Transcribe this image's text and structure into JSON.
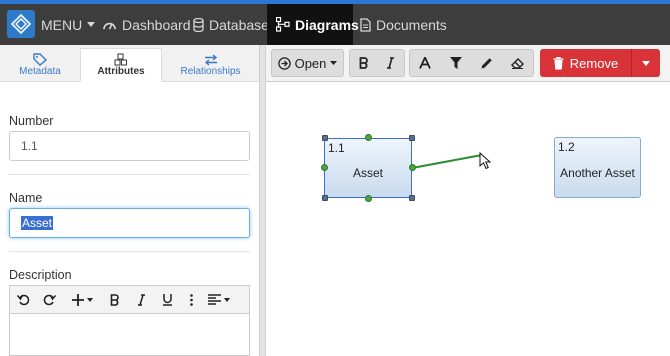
{
  "nav": {
    "menu_label": "MENU",
    "items": [
      {
        "label": "Dashboard"
      },
      {
        "label": "Database"
      },
      {
        "label": "Diagrams"
      },
      {
        "label": "Documents"
      }
    ]
  },
  "left_tabs": [
    {
      "label": "Metadata"
    },
    {
      "label": "Attributes"
    },
    {
      "label": "Relationships"
    }
  ],
  "form": {
    "number_label": "Number",
    "number_value": "1.1",
    "name_label": "Name",
    "name_value": "Asset",
    "description_label": "Description"
  },
  "toolbar": {
    "open_label": "Open",
    "remove_label": "Remove"
  },
  "diagram": {
    "nodes": [
      {
        "number": "1.1",
        "name": "Asset"
      },
      {
        "number": "1.2",
        "name": "Another Asset"
      }
    ]
  },
  "colors": {
    "accent": "#2c7cc9",
    "nav_bg": "#3d3d3d",
    "remove": "#d9333a",
    "connector": "#2e8b2e"
  }
}
